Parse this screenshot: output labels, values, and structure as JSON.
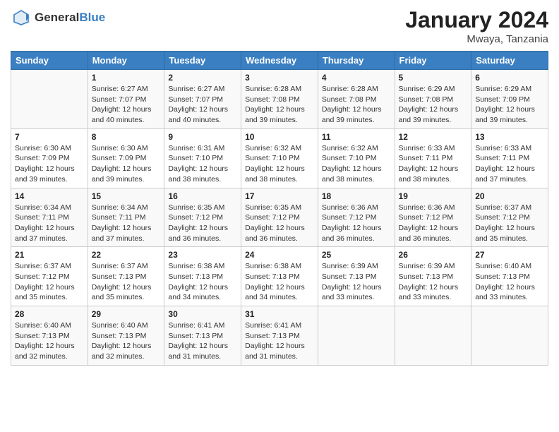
{
  "header": {
    "logo_general": "General",
    "logo_blue": "Blue",
    "month_year": "January 2024",
    "location": "Mwaya, Tanzania"
  },
  "days_of_week": [
    "Sunday",
    "Monday",
    "Tuesday",
    "Wednesday",
    "Thursday",
    "Friday",
    "Saturday"
  ],
  "weeks": [
    [
      {
        "day": "",
        "info": ""
      },
      {
        "day": "1",
        "info": "Sunrise: 6:27 AM\nSunset: 7:07 PM\nDaylight: 12 hours\nand 40 minutes."
      },
      {
        "day": "2",
        "info": "Sunrise: 6:27 AM\nSunset: 7:07 PM\nDaylight: 12 hours\nand 40 minutes."
      },
      {
        "day": "3",
        "info": "Sunrise: 6:28 AM\nSunset: 7:08 PM\nDaylight: 12 hours\nand 39 minutes."
      },
      {
        "day": "4",
        "info": "Sunrise: 6:28 AM\nSunset: 7:08 PM\nDaylight: 12 hours\nand 39 minutes."
      },
      {
        "day": "5",
        "info": "Sunrise: 6:29 AM\nSunset: 7:08 PM\nDaylight: 12 hours\nand 39 minutes."
      },
      {
        "day": "6",
        "info": "Sunrise: 6:29 AM\nSunset: 7:09 PM\nDaylight: 12 hours\nand 39 minutes."
      }
    ],
    [
      {
        "day": "7",
        "info": "Sunrise: 6:30 AM\nSunset: 7:09 PM\nDaylight: 12 hours\nand 39 minutes."
      },
      {
        "day": "8",
        "info": "Sunrise: 6:30 AM\nSunset: 7:09 PM\nDaylight: 12 hours\nand 39 minutes."
      },
      {
        "day": "9",
        "info": "Sunrise: 6:31 AM\nSunset: 7:10 PM\nDaylight: 12 hours\nand 38 minutes."
      },
      {
        "day": "10",
        "info": "Sunrise: 6:32 AM\nSunset: 7:10 PM\nDaylight: 12 hours\nand 38 minutes."
      },
      {
        "day": "11",
        "info": "Sunrise: 6:32 AM\nSunset: 7:10 PM\nDaylight: 12 hours\nand 38 minutes."
      },
      {
        "day": "12",
        "info": "Sunrise: 6:33 AM\nSunset: 7:11 PM\nDaylight: 12 hours\nand 38 minutes."
      },
      {
        "day": "13",
        "info": "Sunrise: 6:33 AM\nSunset: 7:11 PM\nDaylight: 12 hours\nand 37 minutes."
      }
    ],
    [
      {
        "day": "14",
        "info": "Sunrise: 6:34 AM\nSunset: 7:11 PM\nDaylight: 12 hours\nand 37 minutes."
      },
      {
        "day": "15",
        "info": "Sunrise: 6:34 AM\nSunset: 7:11 PM\nDaylight: 12 hours\nand 37 minutes."
      },
      {
        "day": "16",
        "info": "Sunrise: 6:35 AM\nSunset: 7:12 PM\nDaylight: 12 hours\nand 36 minutes."
      },
      {
        "day": "17",
        "info": "Sunrise: 6:35 AM\nSunset: 7:12 PM\nDaylight: 12 hours\nand 36 minutes."
      },
      {
        "day": "18",
        "info": "Sunrise: 6:36 AM\nSunset: 7:12 PM\nDaylight: 12 hours\nand 36 minutes."
      },
      {
        "day": "19",
        "info": "Sunrise: 6:36 AM\nSunset: 7:12 PM\nDaylight: 12 hours\nand 36 minutes."
      },
      {
        "day": "20",
        "info": "Sunrise: 6:37 AM\nSunset: 7:12 PM\nDaylight: 12 hours\nand 35 minutes."
      }
    ],
    [
      {
        "day": "21",
        "info": "Sunrise: 6:37 AM\nSunset: 7:12 PM\nDaylight: 12 hours\nand 35 minutes."
      },
      {
        "day": "22",
        "info": "Sunrise: 6:37 AM\nSunset: 7:13 PM\nDaylight: 12 hours\nand 35 minutes."
      },
      {
        "day": "23",
        "info": "Sunrise: 6:38 AM\nSunset: 7:13 PM\nDaylight: 12 hours\nand 34 minutes."
      },
      {
        "day": "24",
        "info": "Sunrise: 6:38 AM\nSunset: 7:13 PM\nDaylight: 12 hours\nand 34 minutes."
      },
      {
        "day": "25",
        "info": "Sunrise: 6:39 AM\nSunset: 7:13 PM\nDaylight: 12 hours\nand 33 minutes."
      },
      {
        "day": "26",
        "info": "Sunrise: 6:39 AM\nSunset: 7:13 PM\nDaylight: 12 hours\nand 33 minutes."
      },
      {
        "day": "27",
        "info": "Sunrise: 6:40 AM\nSunset: 7:13 PM\nDaylight: 12 hours\nand 33 minutes."
      }
    ],
    [
      {
        "day": "28",
        "info": "Sunrise: 6:40 AM\nSunset: 7:13 PM\nDaylight: 12 hours\nand 32 minutes."
      },
      {
        "day": "29",
        "info": "Sunrise: 6:40 AM\nSunset: 7:13 PM\nDaylight: 12 hours\nand 32 minutes."
      },
      {
        "day": "30",
        "info": "Sunrise: 6:41 AM\nSunset: 7:13 PM\nDaylight: 12 hours\nand 31 minutes."
      },
      {
        "day": "31",
        "info": "Sunrise: 6:41 AM\nSunset: 7:13 PM\nDaylight: 12 hours\nand 31 minutes."
      },
      {
        "day": "",
        "info": ""
      },
      {
        "day": "",
        "info": ""
      },
      {
        "day": "",
        "info": ""
      }
    ]
  ]
}
